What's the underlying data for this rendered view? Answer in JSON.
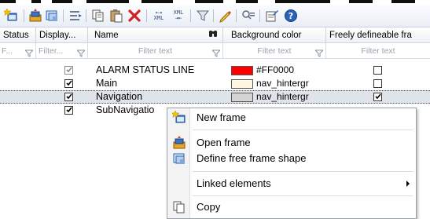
{
  "toolbar": {
    "buttons": [
      {
        "icon": "new-frame-icon"
      },
      {
        "icon": "open-frame-icon"
      },
      {
        "icon": "define-shape-icon"
      },
      {
        "icon": "align-icon"
      },
      {
        "icon": "copy-icon"
      },
      {
        "icon": "paste-icon"
      },
      {
        "icon": "delete-icon"
      },
      {
        "icon": "xml-export-icon",
        "text": "XML"
      },
      {
        "icon": "xml-import-icon",
        "text": "XML"
      },
      {
        "icon": "filter-icon"
      },
      {
        "icon": "edit-icon"
      },
      {
        "icon": "filter-options-icon"
      },
      {
        "icon": "properties-icon"
      },
      {
        "icon": "help-icon"
      }
    ]
  },
  "grid": {
    "columns": [
      {
        "label": "Status"
      },
      {
        "label": "Display..."
      },
      {
        "label": "Name"
      },
      {
        "label": "Background color"
      },
      {
        "label": "Freely defineable fra"
      }
    ],
    "filters": [
      {
        "text": "F..."
      },
      {
        "text": "Filter..."
      },
      {
        "text": "Filter text"
      },
      {
        "text": "Filter text"
      },
      {
        "text": "Filter text"
      }
    ],
    "rows": [
      {
        "name": "ALARM STATUS LINE",
        "display_checked": true,
        "display_disabled": true,
        "bg_color": "#FF0000",
        "bg_label": "#FF0000",
        "freely_checked": false
      },
      {
        "name": "Main",
        "display_checked": true,
        "display_disabled": false,
        "bg_color": "#FFF7E0",
        "bg_label": "nav_hintergr",
        "freely_checked": false
      },
      {
        "name": "Navigation",
        "display_checked": true,
        "display_disabled": false,
        "bg_color": "#D4D4D4",
        "bg_label": "nav_hintergr",
        "freely_checked": true,
        "selected": true
      },
      {
        "name": "SubNavigatio",
        "display_checked": true,
        "display_disabled": false,
        "bg_color": "",
        "bg_label": "",
        "freely_checked": false
      }
    ]
  },
  "context_menu": {
    "items": [
      {
        "label": "New frame",
        "icon": "new-frame-icon"
      },
      {
        "label": "Open frame",
        "icon": "open-frame-icon"
      },
      {
        "label": "Define free frame shape",
        "icon": "define-shape-icon"
      },
      {
        "label": "Linked elements",
        "submenu": true
      },
      {
        "label": "Copy",
        "icon": "copy-icon"
      }
    ]
  },
  "colors": {
    "header_bg": "#eef1f5",
    "selected_row_bg": "#dfe4ea",
    "delete_red": "#d42020",
    "icon_blue": "#2a62b8"
  }
}
